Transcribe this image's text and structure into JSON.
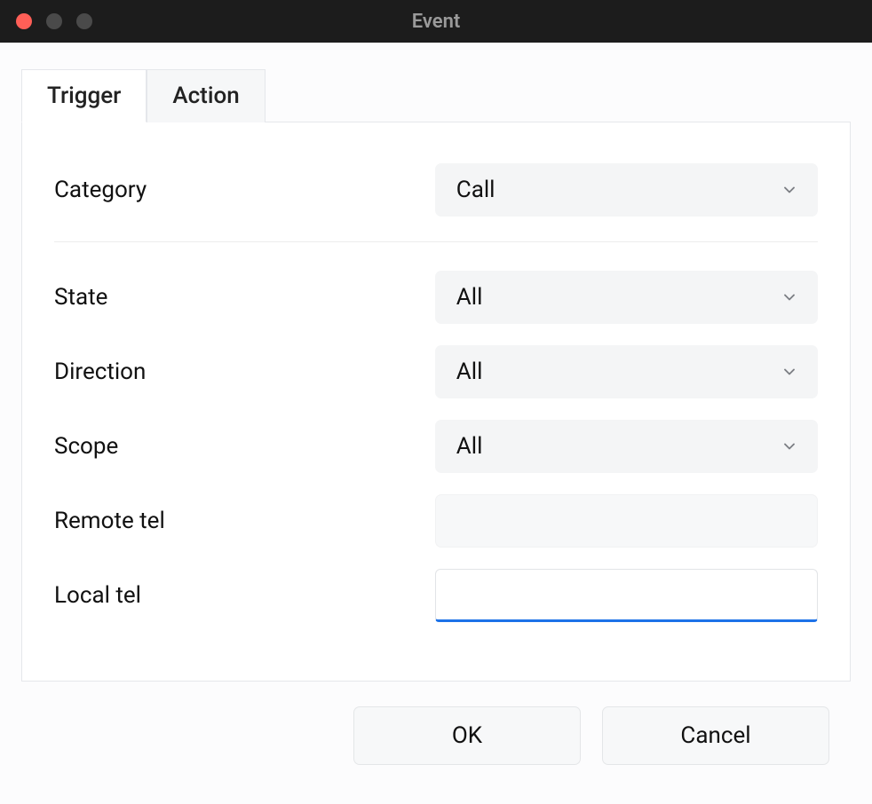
{
  "window": {
    "title": "Event"
  },
  "tabs": {
    "trigger": "Trigger",
    "action": "Action",
    "active": "trigger"
  },
  "form": {
    "category": {
      "label": "Category",
      "value": "Call"
    },
    "state": {
      "label": "State",
      "value": "All"
    },
    "direction": {
      "label": "Direction",
      "value": "All"
    },
    "scope": {
      "label": "Scope",
      "value": "All"
    },
    "remote_tel": {
      "label": "Remote tel",
      "value": ""
    },
    "local_tel": {
      "label": "Local tel",
      "value": ""
    }
  },
  "buttons": {
    "ok": "OK",
    "cancel": "Cancel"
  }
}
